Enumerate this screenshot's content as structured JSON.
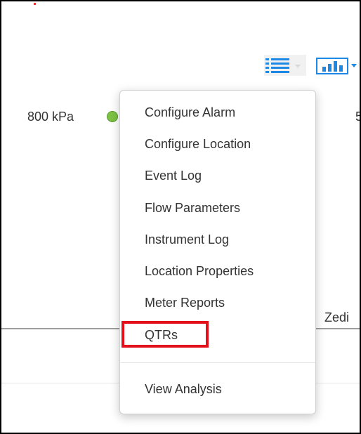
{
  "pressure_reading": "800 kPa",
  "status_color": "#7cc243",
  "right_partial_text": "5",
  "right_label": "Zedi",
  "toolbar": {
    "list_icon": "list-view-icon",
    "chart_icon": "bar-chart-icon",
    "accent": "#1e88e5"
  },
  "menu": {
    "items": [
      {
        "label": "Configure Alarm"
      },
      {
        "label": "Configure Location"
      },
      {
        "label": "Event Log"
      },
      {
        "label": "Flow Parameters"
      },
      {
        "label": "Instrument Log"
      },
      {
        "label": "Location Properties"
      },
      {
        "label": "Meter Reports"
      },
      {
        "label": "QTRs"
      }
    ],
    "after_divider": [
      {
        "label": "View Analysis"
      }
    ],
    "highlight_color": "#e3101b"
  }
}
